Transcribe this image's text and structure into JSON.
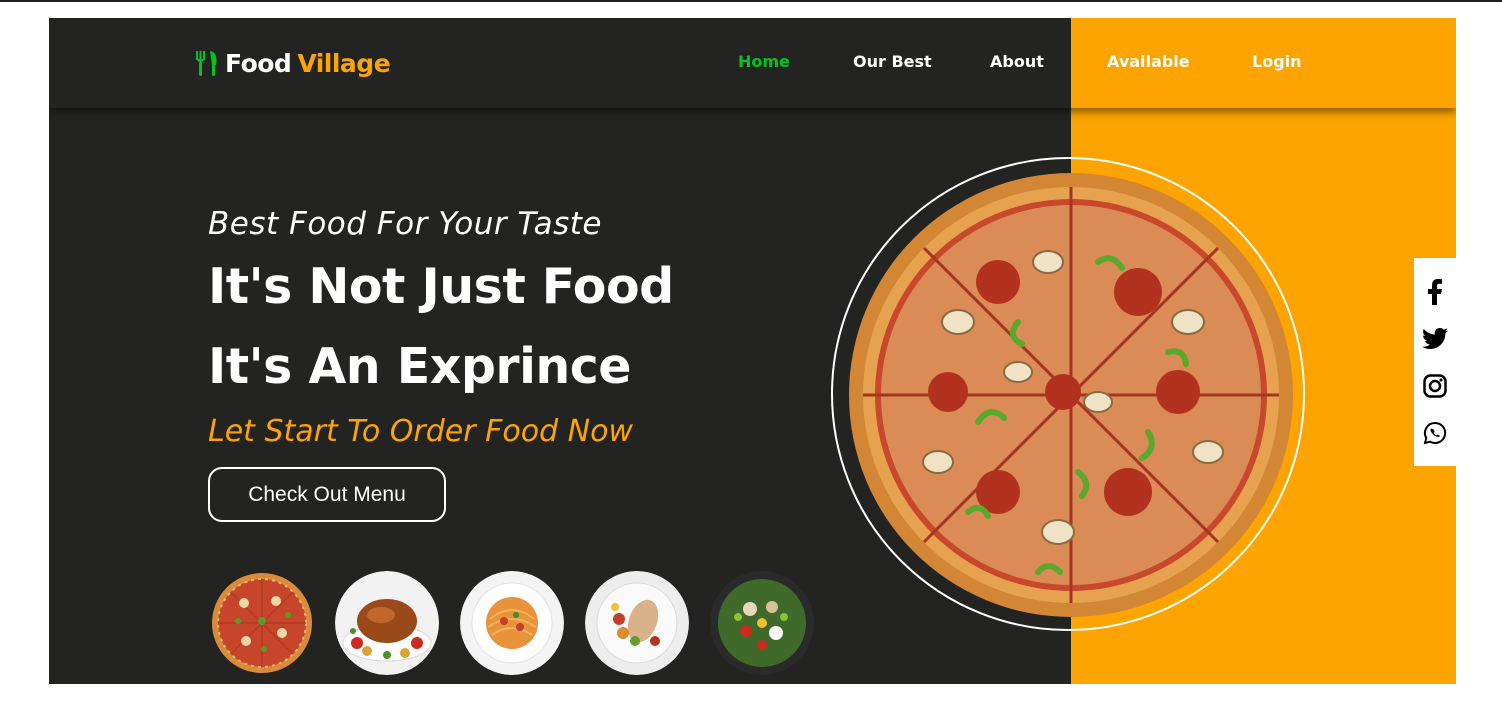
{
  "brand": {
    "name_part1": "Food",
    "name_part2": "Village",
    "logo_icon": "fork-knife-icon",
    "color_accent": "#fea400",
    "color_active": "#00c520",
    "color_dark": "#232421"
  },
  "nav": {
    "items": [
      {
        "label": "Home",
        "active": true
      },
      {
        "label": "Our Best",
        "active": false
      },
      {
        "label": "About",
        "active": false
      },
      {
        "label": "Available",
        "active": false
      },
      {
        "label": "Login",
        "active": false
      }
    ]
  },
  "hero": {
    "subtitle": "Best Food For Your Taste",
    "headline_line1": "It's Not Just Food",
    "headline_line2": "It's An Exprince",
    "tagline": "Let Start To Order Food Now",
    "button_label": "Check Out Menu",
    "main_image": "pizza-image"
  },
  "thumbnails": [
    {
      "name": "pizza-thumbnail"
    },
    {
      "name": "roast-chicken-thumbnail"
    },
    {
      "name": "spaghetti-thumbnail"
    },
    {
      "name": "grilled-chicken-vegetables-thumbnail"
    },
    {
      "name": "salad-bowl-thumbnail"
    }
  ],
  "social": [
    {
      "icon": "facebook-icon"
    },
    {
      "icon": "twitter-icon"
    },
    {
      "icon": "instagram-icon"
    },
    {
      "icon": "whatsapp-icon"
    }
  ]
}
